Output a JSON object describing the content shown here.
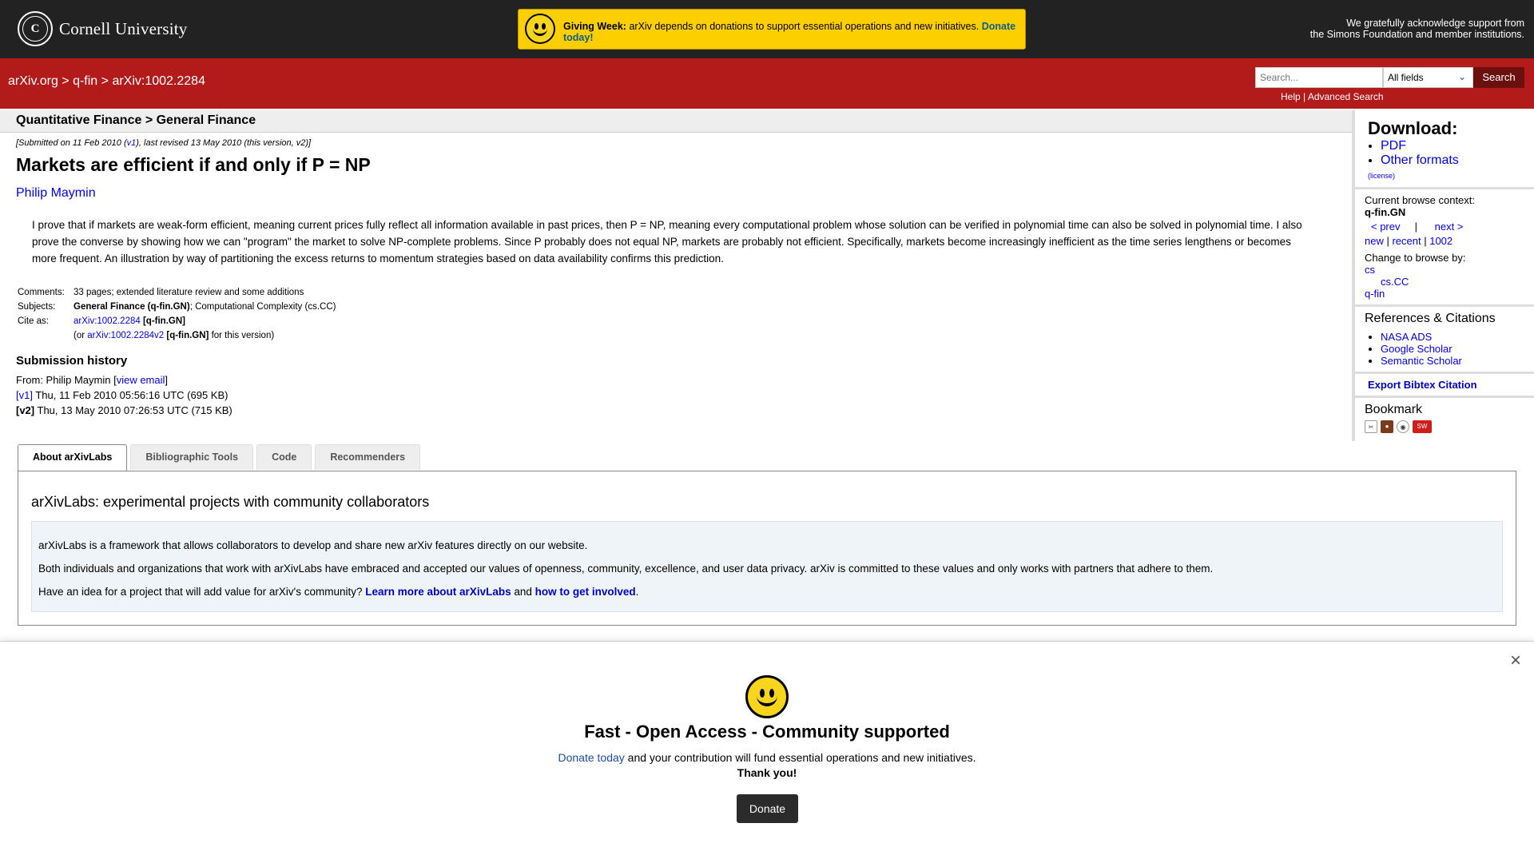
{
  "header": {
    "university": "Cornell University",
    "giving": {
      "title": "Giving Week:",
      "text": "arXiv depends on donations to support essential operations and new initiatives.",
      "donate": "Donate today!"
    },
    "ack_line1": "We gratefully acknowledge support from",
    "ack_line2": "the Simons Foundation and member institutions."
  },
  "nav": {
    "crumb_home": "arXiv.org",
    "crumb_sep1": " > ",
    "crumb_cat": "q-fin",
    "crumb_sep2": " > ",
    "crumb_id": "arXiv:1002.2284",
    "search_placeholder": "Search...",
    "search_field": "All fields",
    "search_button": "Search",
    "help": "Help",
    "help_sep": " | ",
    "advanced": "Advanced Search"
  },
  "paper": {
    "subject_header": "Quantitative Finance > General Finance",
    "submitted_pre": "[Submitted on 11 Feb 2010 (",
    "submitted_v1": "v1",
    "submitted_post": "), last revised 13 May 2010 (this version, v2)]",
    "title": "Markets are efficient if and only if P = NP",
    "author": "Philip Maymin",
    "abstract": "I prove that if markets are weak-form efficient, meaning current prices fully reflect all information available in past prices, then P = NP, meaning every computational problem whose solution can be verified in polynomial time can also be solved in polynomial time. I also prove the converse by showing how we can \"program\" the market to solve NP-complete problems. Since P probably does not equal NP, markets are probably not efficient. Specifically, markets become increasingly inefficient as the time series lengthens or becomes more frequent. An illustration by way of partitioning the excess returns to momentum strategies based on data availability confirms this prediction.",
    "comments_label": "Comments:",
    "comments": "33 pages; extended literature review and some additions",
    "subjects_label": "Subjects:",
    "subjects_primary": "General Finance (q-fin.GN)",
    "subjects_rest": "; Computational Complexity (cs.CC)",
    "cite_label": "Cite as:",
    "cite_id": "arXiv:1002.2284",
    "cite_cat": "[q-fin.GN]",
    "cite2_pre": "(or ",
    "cite2_id": "arXiv:1002.2284v2",
    "cite2_cat": "[q-fin.GN]",
    "cite2_post": " for this version)"
  },
  "history": {
    "heading": "Submission history",
    "from_pre": "From: Philip Maymin [",
    "from_link": "view email",
    "from_post": "]",
    "v1_label": "[v1]",
    "v1_text": " Thu, 11 Feb 2010 05:56:16 UTC (695 KB)",
    "v2_label": "[v2]",
    "v2_text": " Thu, 13 May 2010 07:26:53 UTC (715 KB)"
  },
  "sidebar": {
    "download_heading": "Download:",
    "pdf": "PDF",
    "other_formats": "Other formats",
    "license": "(license)",
    "context_label": "Current browse context:",
    "context": "q-fin.GN",
    "prev": "< prev",
    "pipe": "|",
    "next": "next >",
    "new": "new",
    "recent": "recent",
    "month": "1002",
    "change_label": "Change to browse by:",
    "browse_cs": "cs",
    "browse_cscc": "cs.CC",
    "browse_qfin": "q-fin",
    "refs_heading": "References & Citations",
    "ref_nasa": "NASA ADS",
    "ref_google": "Google Scholar",
    "ref_semantic": "Semantic Scholar",
    "bibtex": "Export Bibtex Citation",
    "bookmark_heading": "Bookmark"
  },
  "labs": {
    "tabs": [
      "About arXivLabs",
      "Bibliographic Tools",
      "Code",
      "Recommenders"
    ],
    "heading": "arXivLabs: experimental projects with community collaborators",
    "p1": "arXivLabs is a framework that allows collaborators to develop and share new arXiv features directly on our website.",
    "p2": "Both individuals and organizations that work with arXivLabs have embraced and accepted our values of openness, community, excellence, and user data privacy. arXiv is committed to these values and only works with partners that adhere to them.",
    "p3_pre": "Have an idea for a project that will add value for arXiv's community? ",
    "p3_link1": "Learn more about arXivLabs",
    "p3_mid": " and ",
    "p3_link2": "how to get involved",
    "p3_post": "."
  },
  "modal": {
    "close": "×",
    "heading": "Fast - Open Access - Community supported",
    "donate_link": "Donate today",
    "text": " and your contribution will fund essential operations and new initiatives.",
    "thanks": "Thank you!",
    "button": "Donate"
  }
}
